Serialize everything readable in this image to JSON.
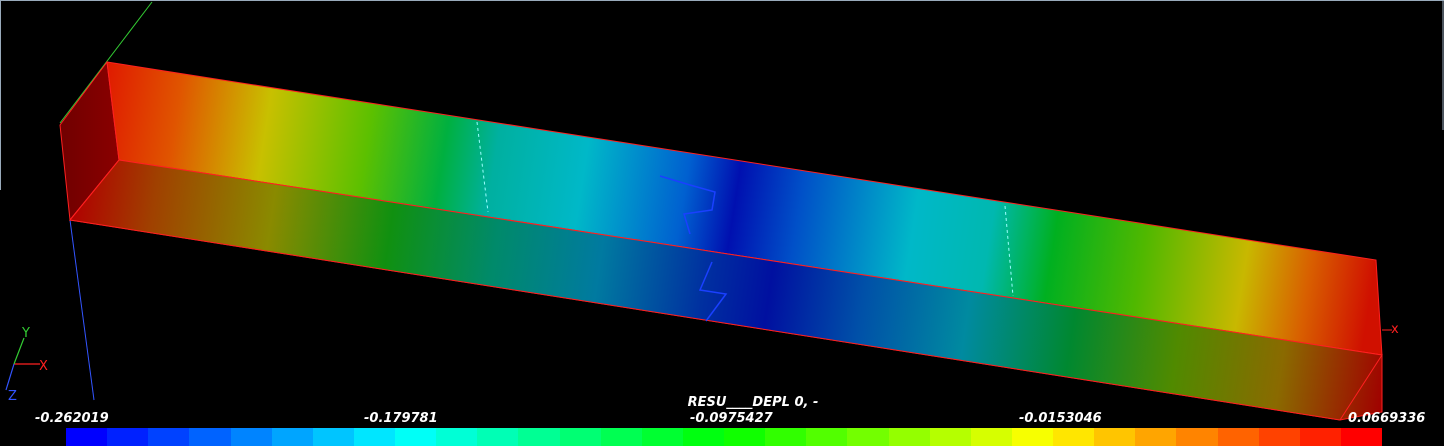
{
  "scalar_bar": {
    "title": "RESU____DEPL 0, -",
    "ticks": [
      "-0.262019",
      "-0.179781",
      "-0.0975427",
      "-0.0153046",
      "0.0669336"
    ],
    "segments": 32
  },
  "axes": {
    "x": "X",
    "y": "Y",
    "z": "Z"
  },
  "corner_axis_label": "x",
  "colors": {
    "background": "#000000",
    "beam_edges": "#ff2020",
    "axis_x": "#ff2020",
    "axis_y": "#33cc33",
    "axis_z": "#3355ff",
    "colormap": [
      "#0000ff",
      "#00ffff",
      "#00ff00",
      "#ffff00",
      "#ff0000"
    ]
  }
}
